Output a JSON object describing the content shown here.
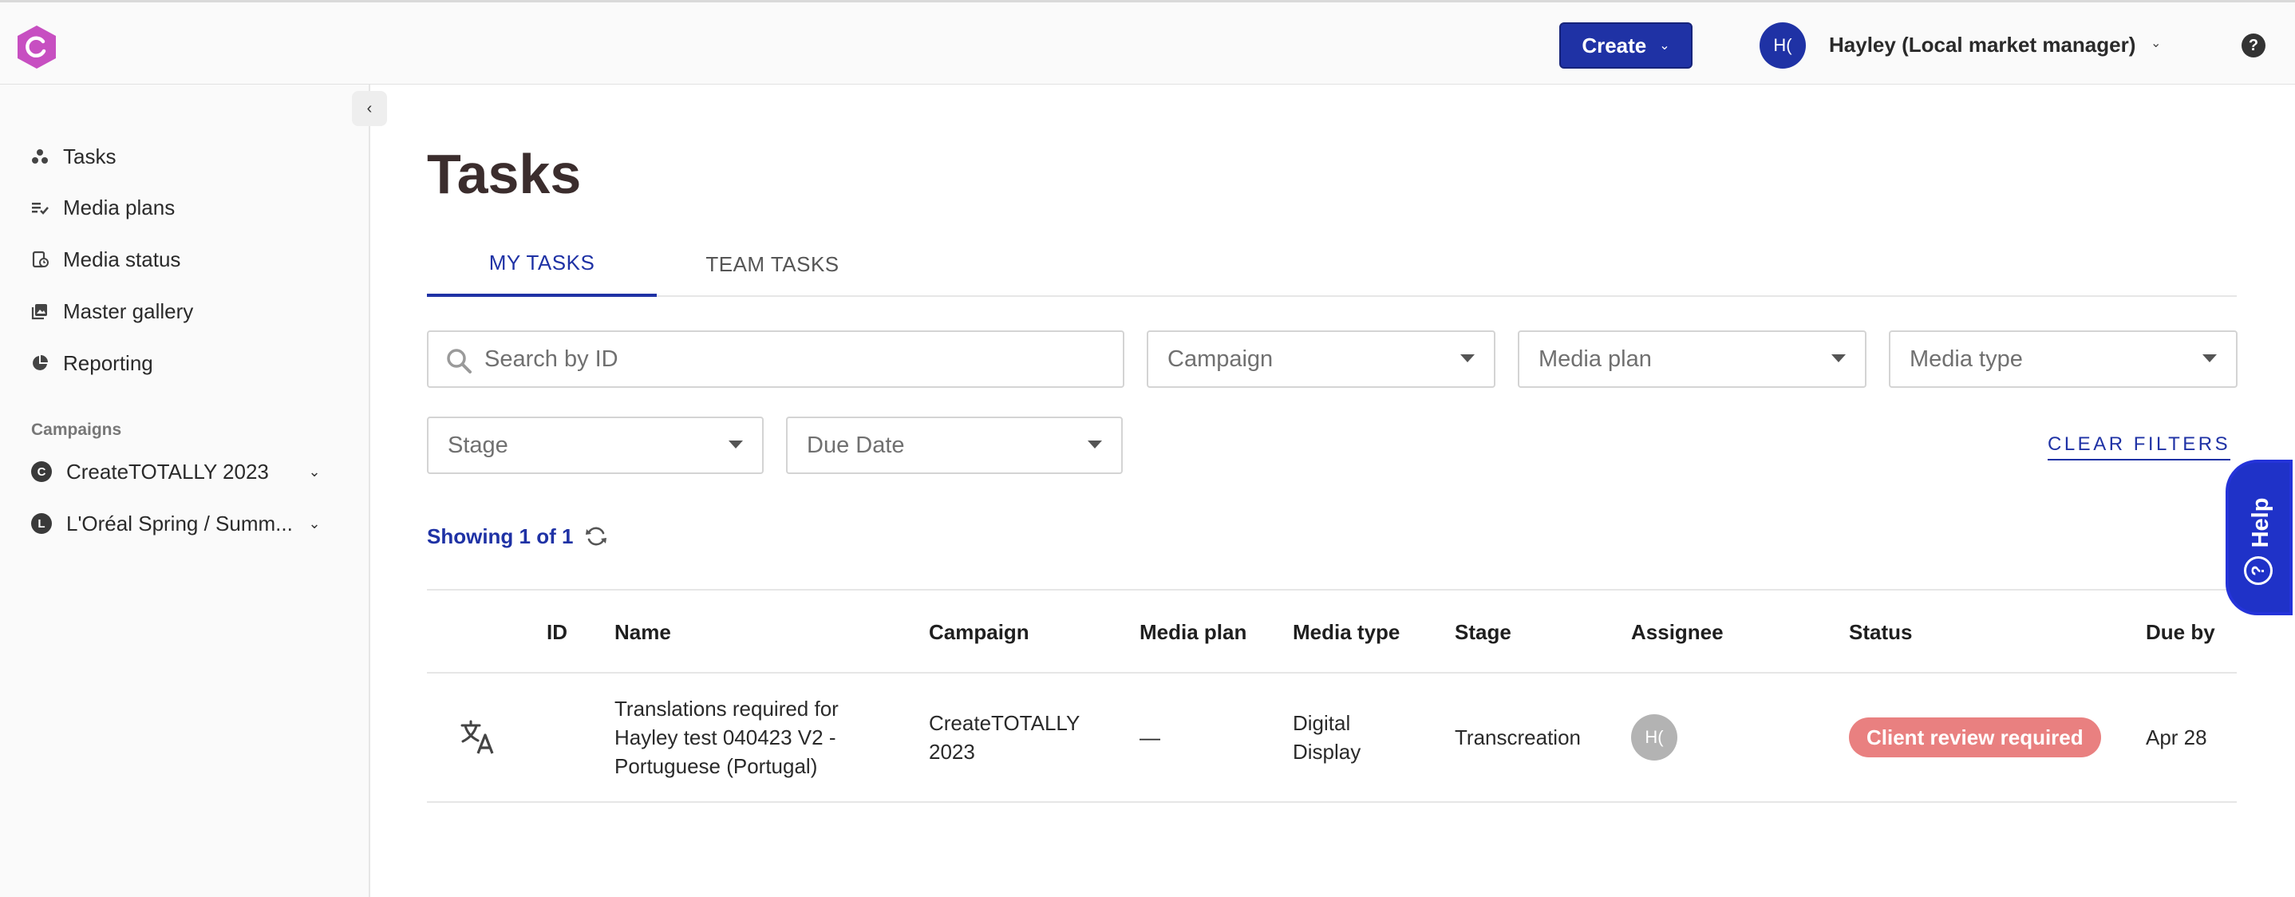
{
  "topbar": {
    "create_label": "Create",
    "user_initials": "H(",
    "user_name": "Hayley (Local market manager)",
    "help_glyph": "?"
  },
  "sidebar": {
    "nav": [
      {
        "label": "Tasks",
        "icon": "tasks-icon"
      },
      {
        "label": "Media plans",
        "icon": "media-plans-icon"
      },
      {
        "label": "Media status",
        "icon": "media-status-icon"
      },
      {
        "label": "Master gallery",
        "icon": "gallery-icon"
      },
      {
        "label": "Reporting",
        "icon": "reporting-icon"
      }
    ],
    "section_label": "Campaigns",
    "campaigns": [
      {
        "badge": "C",
        "label": "CreateTOTALLY 2023"
      },
      {
        "badge": "L",
        "label": "L'Oréal Spring / Summ..."
      }
    ]
  },
  "main": {
    "title": "Tasks",
    "tabs": [
      {
        "label": "MY TASKS",
        "active": true
      },
      {
        "label": "TEAM TASKS",
        "active": false
      }
    ],
    "filters": {
      "search_placeholder": "Search by ID",
      "campaign": "Campaign",
      "media_plan": "Media plan",
      "media_type": "Media type",
      "stage": "Stage",
      "due_date": "Due Date",
      "clear_label": "CLEAR FILTERS"
    },
    "showing": "Showing 1 of 1"
  },
  "table": {
    "headers": {
      "id": "ID",
      "name": "Name",
      "campaign": "Campaign",
      "media_plan": "Media plan",
      "media_type": "Media type",
      "stage": "Stage",
      "assignee": "Assignee",
      "status": "Status",
      "due_by": "Due by"
    },
    "rows": [
      {
        "type_icon": "translate-icon",
        "id": "",
        "name": "Translations required for Hayley test 040423 V2 - Portuguese (Portugal)",
        "campaign": "CreateTOTALLY 2023",
        "media_plan": "—",
        "media_type": "Digital Display",
        "stage": "Transcreation",
        "assignee_initials": "H(",
        "status": "Client review required",
        "due_by": "Apr 28"
      }
    ]
  },
  "help_widget": {
    "label": "Help",
    "glyph": "?"
  },
  "colors": {
    "brand": "#1f32a5",
    "status_client_review": "#e98080",
    "logo": "#c74fc1"
  }
}
